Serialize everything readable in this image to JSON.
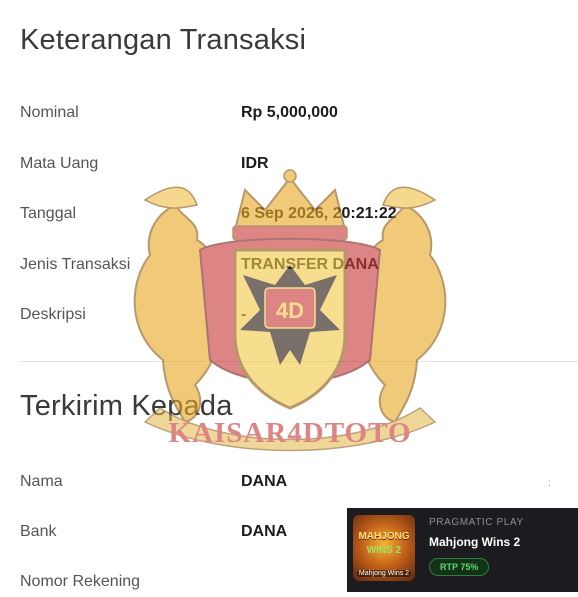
{
  "transaction": {
    "title": "Keterangan Transaksi",
    "rows": [
      {
        "label": "Nominal",
        "value": "Rp 5,000,000"
      },
      {
        "label": "Mata Uang",
        "value": "IDR"
      },
      {
        "label": "Tanggal",
        "value": "6 Sep 2026, 20:21:22"
      },
      {
        "label": "Jenis Transaksi",
        "value": "TRANSFER DANA"
      },
      {
        "label": "Deskripsi",
        "value": "-"
      }
    ]
  },
  "recipient": {
    "title": "Terkirim Kepada",
    "rows": [
      {
        "label": "Nama",
        "value": "DANA"
      },
      {
        "label": "Bank",
        "value": "DANA"
      },
      {
        "label": "Nomor Rekening",
        "value": ""
      }
    ]
  },
  "watermark": {
    "brand": "KAISAR4DTOTO",
    "emblem": "4D",
    "colors": {
      "gold": "#e8a928",
      "red": "#c93a3a",
      "dark": "#2a1a12"
    }
  },
  "promo": {
    "provider": "PRAGMATIC PLAY",
    "game": "Mahjong Wins 2",
    "rtp": "RTP 75%",
    "thumb_title_1": "MAHJONG",
    "thumb_title_2": "WINS 2",
    "thumb_caption": "Mahjong Wins 2",
    "colors": {
      "background": "#1c1b1f",
      "rtp_green": "#5fd86e"
    }
  },
  "misc": {
    "stray_mark": ":"
  }
}
